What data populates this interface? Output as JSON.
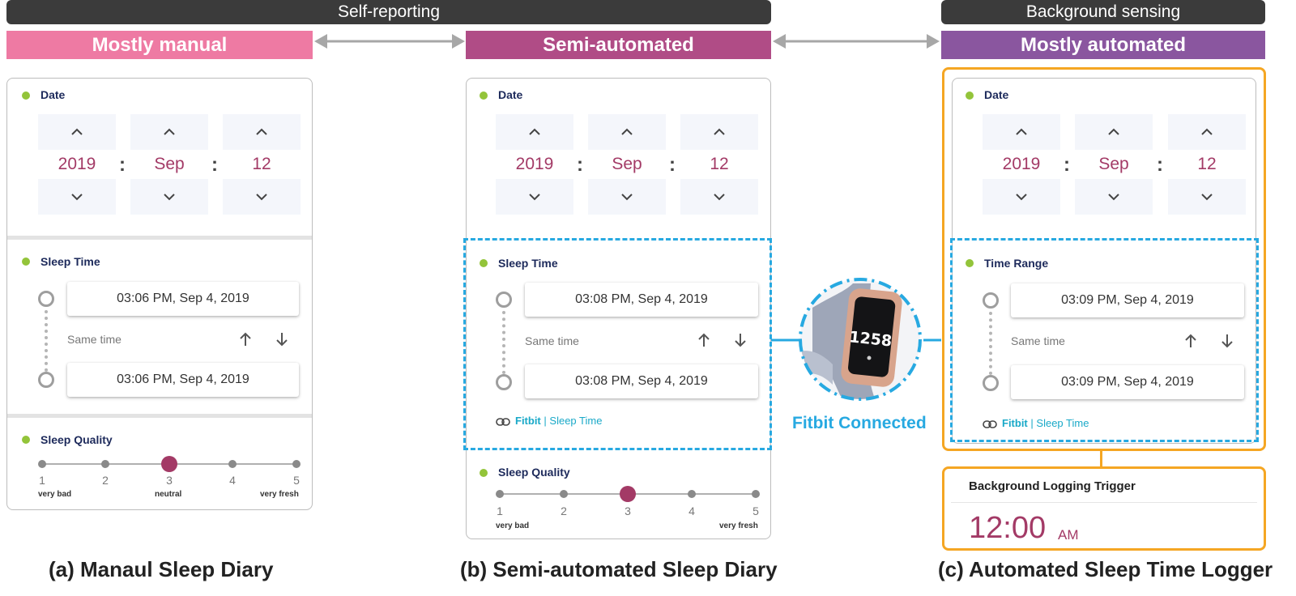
{
  "top": {
    "self_reporting": "Self-reporting",
    "background_sensing": "Background sensing",
    "modes": [
      "Mostly manual",
      "Semi-automated",
      "Mostly automated"
    ],
    "colors": {
      "manual": "#ee7aa3",
      "semi": "#b04c86",
      "auto": "#8a569f",
      "dark": "#3b3b3b"
    }
  },
  "panel_a": {
    "date_title": "Date",
    "date": {
      "year": "2019",
      "month": "Sep",
      "day": "12"
    },
    "sleep_title": "Sleep Time",
    "time_start": "03:06 PM, Sep 4, 2019",
    "same_time": "Same time",
    "time_end": "03:06 PM, Sep 4, 2019",
    "quality_title": "Sleep Quality",
    "scale": [
      "1",
      "2",
      "3",
      "4",
      "5"
    ],
    "scale_labels": {
      "low": "very bad",
      "mid": "neutral",
      "high": "very fresh"
    },
    "quality_value": 3,
    "caption": "(a) Manaul Sleep Diary"
  },
  "panel_b": {
    "date_title": "Date",
    "date": {
      "year": "2019",
      "month": "Sep",
      "day": "12"
    },
    "sleep_title": "Sleep Time",
    "time_start": "03:08 PM, Sep 4, 2019",
    "same_time": "Same time",
    "time_end": "03:08 PM, Sep 4, 2019",
    "link_source": "Fitbit",
    "link_sep": "|",
    "link_target": "Sleep Time",
    "quality_title": "Sleep Quality",
    "scale": [
      "1",
      "2",
      "3",
      "4",
      "5"
    ],
    "scale_labels": {
      "low": "very bad",
      "high": "very fresh"
    },
    "quality_value": 3,
    "caption": "(b) Semi-automated Sleep Diary"
  },
  "fitbit": {
    "label": "Fitbit Connected",
    "watch_time": "1258",
    "accent": "#27a9e1"
  },
  "panel_c": {
    "date_title": "Date",
    "date": {
      "year": "2019",
      "month": "Sep",
      "day": "12"
    },
    "range_title": "Time Range",
    "time_start": "03:09 PM, Sep 4, 2019",
    "same_time": "Same time",
    "time_end": "03:09 PM, Sep 4, 2019",
    "link_source": "Fitbit",
    "link_sep": "|",
    "link_target": "Sleep Time",
    "trigger_title": "Background Logging Trigger",
    "trigger_time": "12:00",
    "trigger_ampm": "AM",
    "caption": "(c) Automated Sleep Time Logger"
  }
}
